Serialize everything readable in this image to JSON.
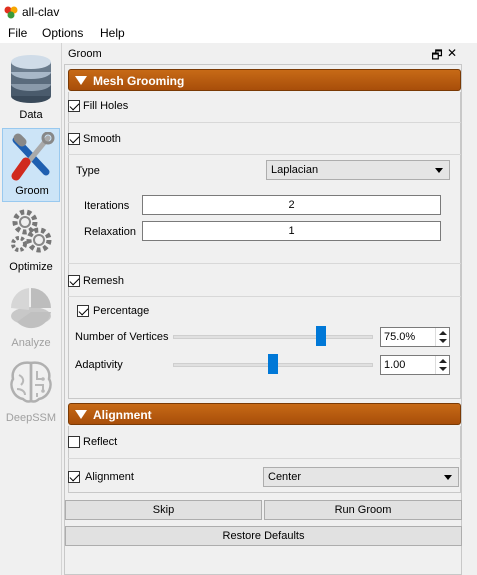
{
  "window": {
    "title": "all-clav"
  },
  "menu": {
    "file": "File",
    "options": "Options",
    "help": "Help"
  },
  "toolbar": {
    "data": "Data",
    "groom": "Groom",
    "optimize": "Optimize",
    "analyze": "Analyze",
    "deepssm": "DeepSSM"
  },
  "dock": {
    "title": "Groom",
    "float_glyph": "🗗",
    "close_glyph": "✕"
  },
  "mesh_grooming": {
    "title": "Mesh Grooming",
    "fill_holes": {
      "label": "Fill Holes",
      "checked": true
    },
    "smooth": {
      "label": "Smooth",
      "checked": true
    },
    "type_label": "Type",
    "type_value": "Laplacian",
    "iterations_label": "Iterations",
    "iterations_value": "2",
    "relaxation_label": "Relaxation",
    "relaxation_value": "1",
    "remesh": {
      "label": "Remesh",
      "checked": true
    },
    "percentage": {
      "label": "Percentage",
      "checked": true
    },
    "num_vertices_label": "Number of Vertices",
    "num_vertices_value": "75.0%",
    "num_vertices_level": 0.75,
    "adaptivity_label": "Adaptivity",
    "adaptivity_value": "1.00",
    "adaptivity_level": 0.5
  },
  "alignment": {
    "title": "Alignment",
    "reflect": {
      "label": "Reflect",
      "checked": false
    },
    "alignment_check": {
      "label": "Alignment",
      "checked": true
    },
    "alignment_value": "Center"
  },
  "buttons": {
    "skip": "Skip",
    "run_groom": "Run Groom",
    "restore_defaults": "Restore Defaults"
  },
  "colors": {
    "section_header": "#b85a10",
    "slider_handle": "#0078d7",
    "selected_tool": "#cce4f7"
  }
}
